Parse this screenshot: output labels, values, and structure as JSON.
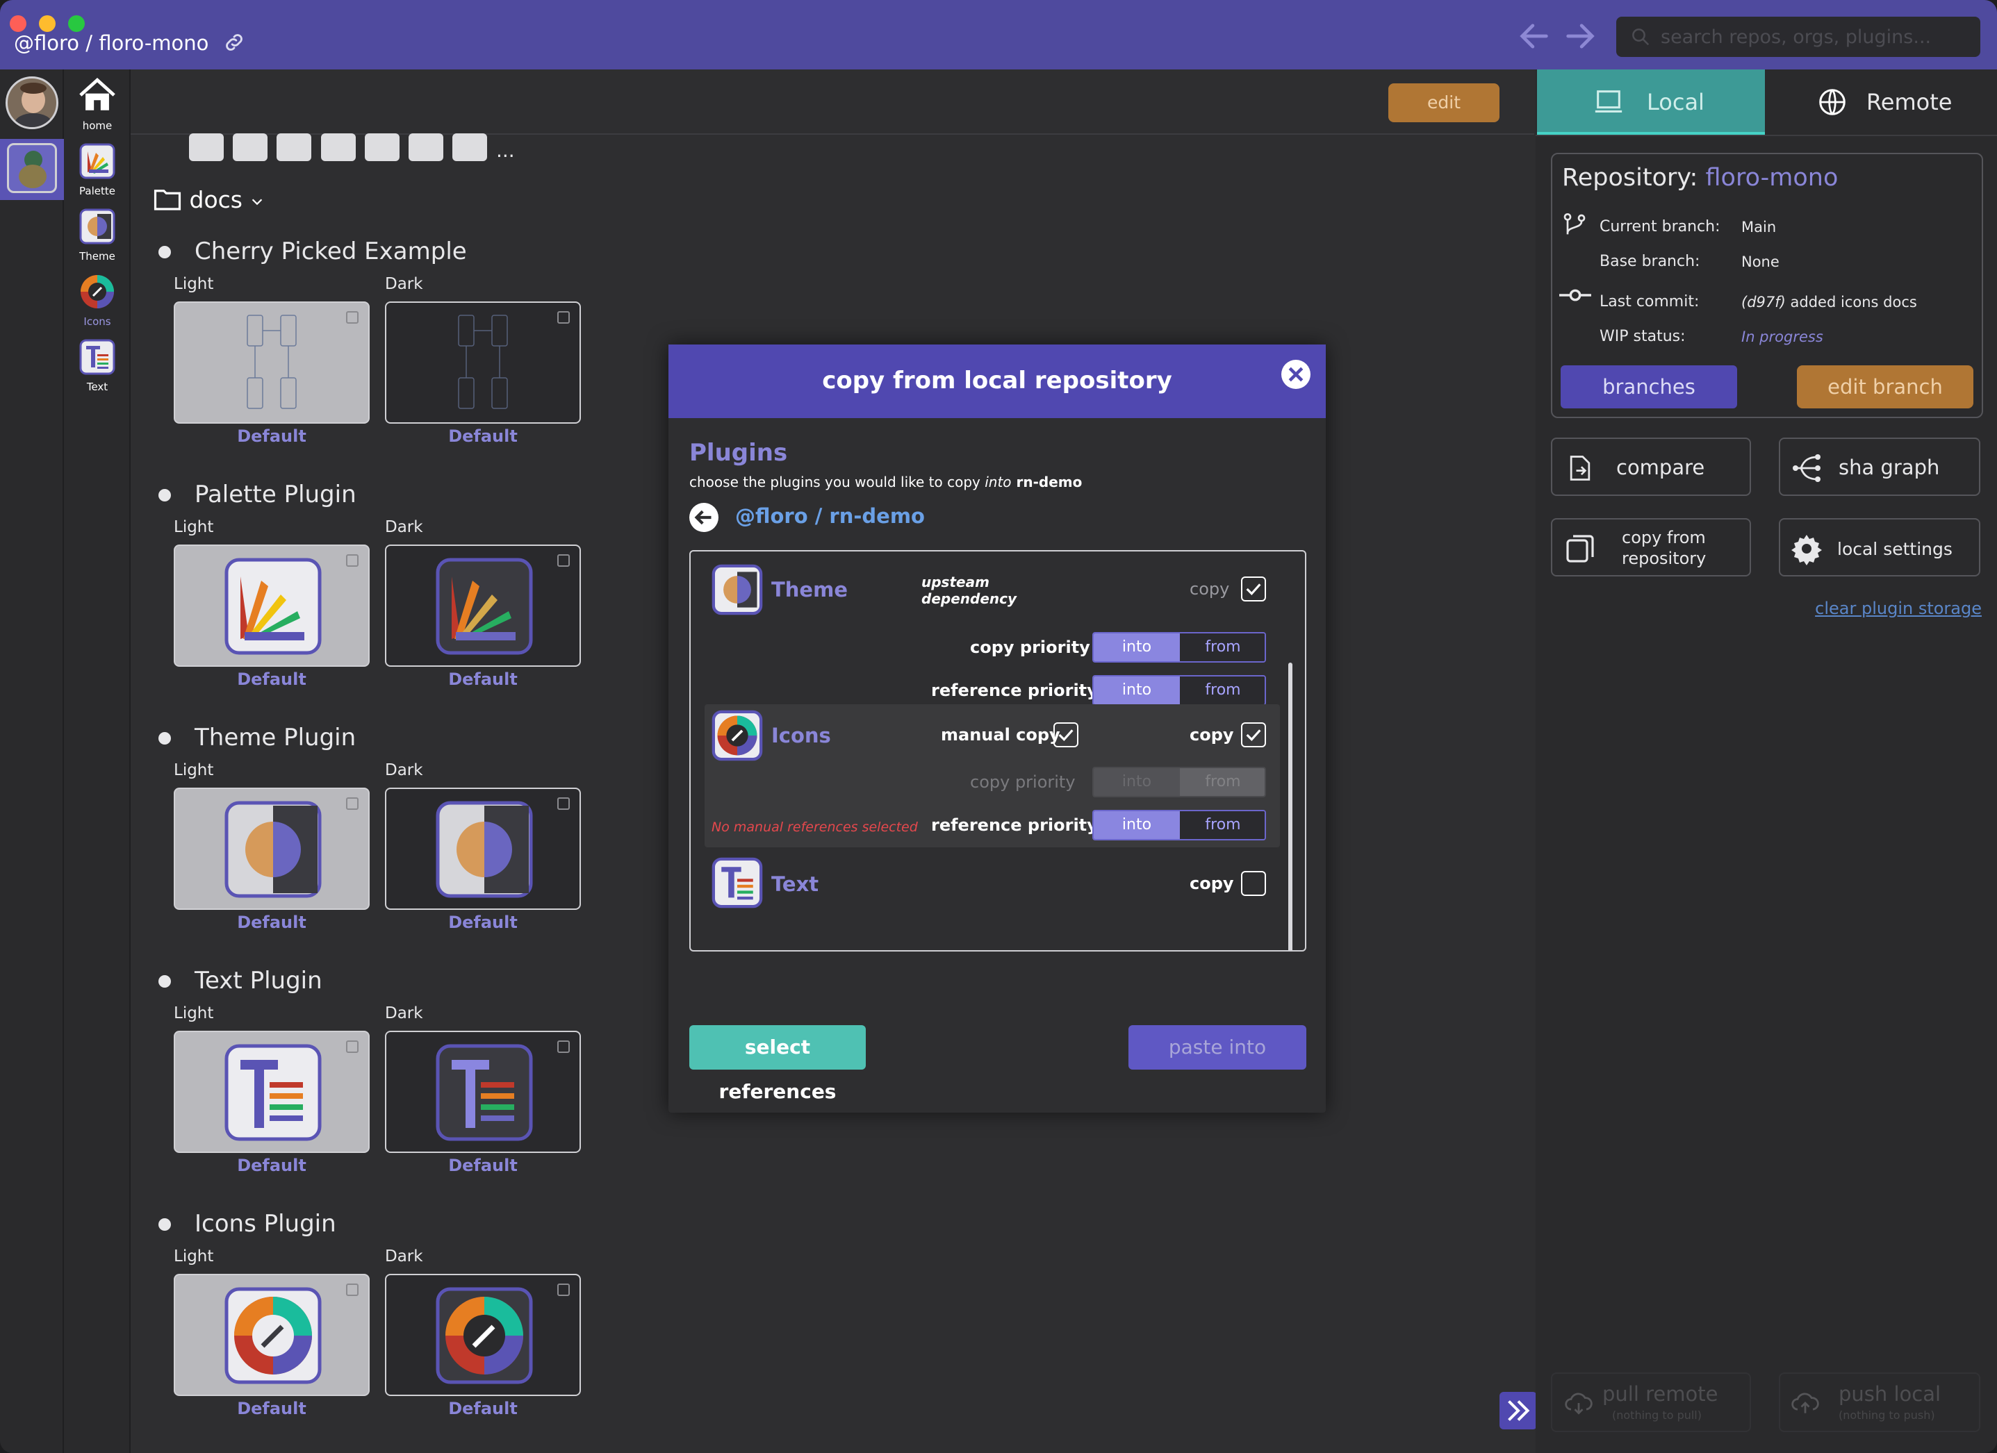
{
  "window": {
    "breadcrumb": "@floro / floro-mono",
    "search_placeholder": "search repos, orgs, plugins..."
  },
  "iconbar": {
    "items": [
      {
        "label": "home"
      },
      {
        "label": "Palette"
      },
      {
        "label": "Theme"
      },
      {
        "label": "Icons"
      },
      {
        "label": "Text"
      }
    ]
  },
  "main": {
    "edit_label": "edit",
    "more_label": "...",
    "folder_label": "docs",
    "sections": [
      {
        "title": "Cherry Picked Example",
        "light": "Light",
        "dark": "Dark",
        "card_label": "Default"
      },
      {
        "title": "Palette Plugin",
        "light": "Light",
        "dark": "Dark",
        "card_label": "Default"
      },
      {
        "title": "Theme Plugin",
        "light": "Light",
        "dark": "Dark",
        "card_label": "Default"
      },
      {
        "title": "Text Plugin",
        "light": "Light",
        "dark": "Dark",
        "card_label": "Default"
      },
      {
        "title": "Icons Plugin",
        "light": "Light",
        "dark": "Dark",
        "card_label": "Default"
      }
    ]
  },
  "right": {
    "tab_local": "Local",
    "tab_remote": "Remote",
    "repo_label": "Repository:",
    "repo_name": "floro-mono",
    "current_branch_label": "Current branch:",
    "current_branch": "Main",
    "base_branch_label": "Base branch:",
    "base_branch": "None",
    "last_commit_label": "Last commit:",
    "last_commit_sha": "(d97f)",
    "last_commit_msg": "added icons docs",
    "wip_label": "WIP status:",
    "wip_value": "In progress",
    "branches": "branches",
    "edit_branch": "edit branch",
    "compare": "compare",
    "sha_graph": "sha graph",
    "copy_from_1": "copy from",
    "copy_from_2": "repository",
    "local_settings": "local settings",
    "clear_storage": "clear plugin storage",
    "pull_remote": "pull remote",
    "pull_sub": "(nothing to pull)",
    "push_local": "push local",
    "push_sub": "(nothing to push)"
  },
  "modal": {
    "title": "copy from local repository",
    "plugins_heading": "Plugins",
    "subtitle_pre": "choose the plugins you would like to copy ",
    "subtitle_into": "into",
    "subtitle_target": " rn-demo",
    "repo_link": "@floro / rn-demo",
    "plugins": [
      {
        "name": "Theme",
        "note": "upsteam dependency",
        "copy_label": "copy",
        "copy_checked": true,
        "copy_priority": "copy priority",
        "reference_priority": "reference priority",
        "into": "into",
        "from": "from"
      },
      {
        "name": "Icons",
        "manual_copy": "manual copy",
        "copy_label": "copy",
        "copy_checked": true,
        "copy_priority": "copy priority",
        "reference_priority": "reference priority",
        "into": "into",
        "from": "from",
        "warning": "No manual references selected"
      },
      {
        "name": "Text",
        "copy_label": "copy",
        "copy_checked": false
      }
    ],
    "select_references": "select references",
    "paste_into": "paste into"
  },
  "colors": {
    "accent": "#5048b0",
    "purple_text": "#8a86d8",
    "orange": "#b07634",
    "teal": "#4fc1b3",
    "warning": "#e5484d"
  }
}
